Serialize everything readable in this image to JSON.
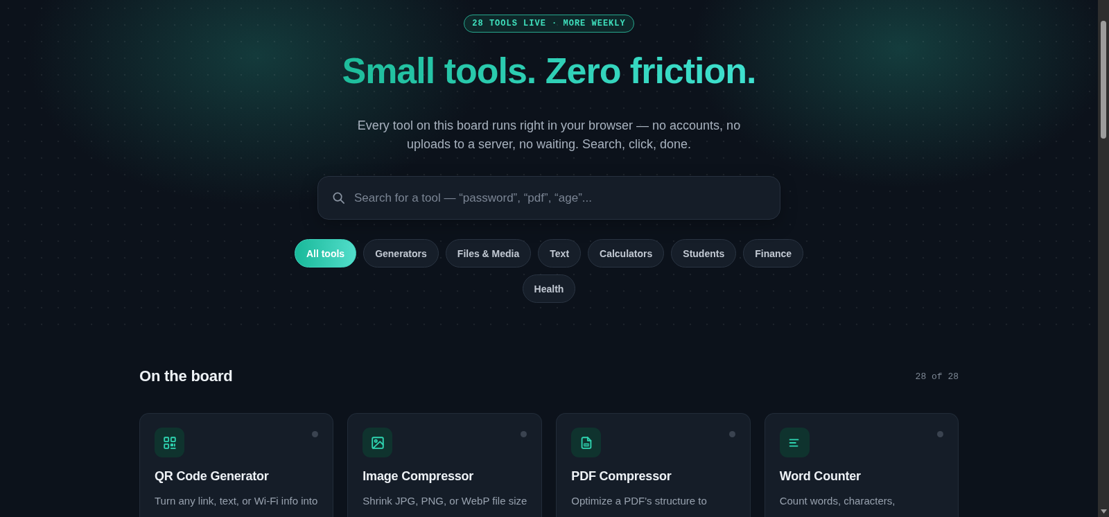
{
  "badge": "28 TOOLS LIVE · MORE WEEKLY",
  "headline": "Small tools. Zero friction.",
  "subtitle": "Every tool on this board runs right in your browser — no accounts, no uploads to a server, no waiting. Search, click, done.",
  "search": {
    "placeholder": "Search for a tool — “password”, “pdf”, “age”..."
  },
  "filters": [
    {
      "label": "All tools",
      "selected": true
    },
    {
      "label": "Generators",
      "selected": false
    },
    {
      "label": "Files & Media",
      "selected": false
    },
    {
      "label": "Text",
      "selected": false
    },
    {
      "label": "Calculators",
      "selected": false
    },
    {
      "label": "Students",
      "selected": false
    },
    {
      "label": "Finance",
      "selected": false
    },
    {
      "label": "Health",
      "selected": false
    }
  ],
  "board": {
    "title": "On the board",
    "count": "28 of 28",
    "tools": [
      {
        "name": "QR Code Generator",
        "description": "Turn any link, text, or Wi-Fi info into"
      },
      {
        "name": "Image Compressor",
        "description": "Shrink JPG, PNG, or WebP file size"
      },
      {
        "name": "PDF Compressor",
        "description": "Optimize a PDF's structure to"
      },
      {
        "name": "Word Counter",
        "description": "Count words, characters,"
      }
    ]
  }
}
